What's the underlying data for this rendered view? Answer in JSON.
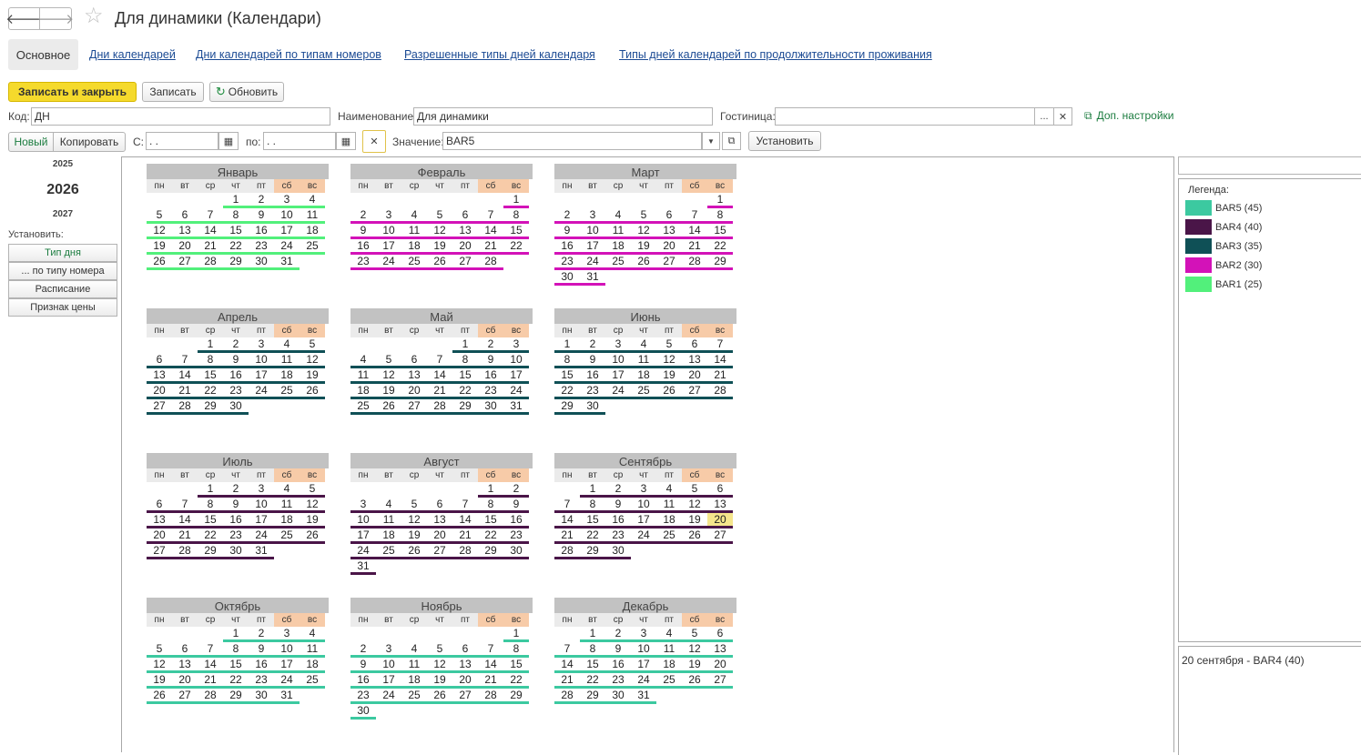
{
  "title": "Для динамики (Календари)",
  "tabs": [
    "Основное",
    "Дни календарей",
    "Дни календарей по типам номеров",
    "Разрешенные типы дней календаря",
    "Типы дней календарей по продолжительности проживания"
  ],
  "toolbar": {
    "save_close": "Записать и закрыть",
    "save": "Записать",
    "refresh": "Обновить"
  },
  "form": {
    "code_label": "Код:",
    "code_value": "ДН",
    "name_label": "Наименование:",
    "name_value": "Для динамики",
    "hotel_label": "Гостиница:",
    "hotel_value": "",
    "dop": "Доп. настройки",
    "new": "Новый",
    "copy": "Копировать",
    "from_label": "С:",
    "from_value": " .  .",
    "to_label": "по:",
    "to_value": " .  .",
    "value_label": "Значение:",
    "value_value": "BAR5",
    "set": "Установить"
  },
  "years": {
    "prev": "2025",
    "current": "2026",
    "next": "2027"
  },
  "set_label": "Установить:",
  "set_buttons": [
    "Тип дня",
    "... по типу номера",
    "Расписание",
    "Признак цены"
  ],
  "weekdays": [
    "пн",
    "вт",
    "ср",
    "чт",
    "пт",
    "сб",
    "вс"
  ],
  "legend_title": "Легенда:",
  "legend": [
    {
      "name": "BAR5 (45)",
      "color": "#3cc9a0"
    },
    {
      "name": "BAR4 (40)",
      "color": "#4a1548"
    },
    {
      "name": "BAR3 (35)",
      "color": "#0f5056"
    },
    {
      "name": "BAR2 (30)",
      "color": "#d312b8"
    },
    {
      "name": "BAR1 (25)",
      "color": "#52f07b"
    }
  ],
  "info": "20 сентября - BAR4 (40)",
  "months": [
    {
      "name": "Январь",
      "days": 31,
      "offset": 3,
      "colors": [
        "BAR1"
      ]
    },
    {
      "name": "Февраль",
      "days": 28,
      "offset": 6,
      "colors": [
        "BAR2"
      ]
    },
    {
      "name": "Март",
      "days": 31,
      "offset": 6,
      "colors": [
        "BAR2"
      ]
    },
    {
      "name": "Апрель",
      "days": 30,
      "offset": 2,
      "colors": [
        "BAR3"
      ]
    },
    {
      "name": "Май",
      "days": 31,
      "offset": 4,
      "colors": [
        "BAR3"
      ]
    },
    {
      "name": "Июнь",
      "days": 30,
      "offset": 0,
      "colors": [
        "BAR3"
      ]
    },
    {
      "name": "Июль",
      "days": 31,
      "offset": 2,
      "colors": [
        "BAR4"
      ]
    },
    {
      "name": "Август",
      "days": 31,
      "offset": 5,
      "colors": [
        "BAR4"
      ]
    },
    {
      "name": "Сентябрь",
      "days": 30,
      "offset": 1,
      "colors": [
        "BAR4"
      ],
      "highlight": 20
    },
    {
      "name": "Октябрь",
      "days": 31,
      "offset": 3,
      "colors": [
        "BAR5"
      ]
    },
    {
      "name": "Ноябрь",
      "days": 30,
      "offset": 6,
      "colors": [
        "BAR5"
      ]
    },
    {
      "name": "Декабрь",
      "days": 31,
      "offset": 1,
      "colors": [
        "BAR5"
      ]
    }
  ]
}
